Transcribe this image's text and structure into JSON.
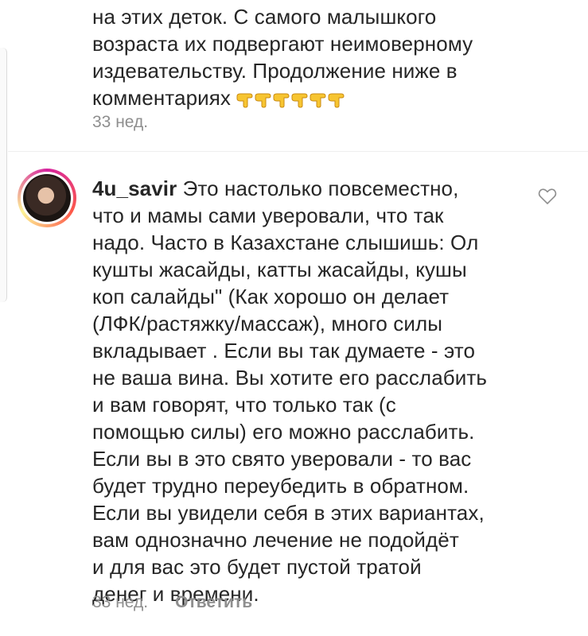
{
  "previous_comment": {
    "lines": [
      "на этих деток. С самого малышкого",
      "возраста их подвергают неимоверному",
      "издевательству. Продолжение ниже в",
      "комментариях"
    ],
    "emoji_icons": [
      "pointing-hand-icon",
      "pointing-hand-icon",
      "pointing-hand-icon",
      "pointing-hand-icon",
      "pointing-hand-icon",
      "pointing-hand-icon"
    ],
    "time": "33 нед."
  },
  "comment": {
    "username": "4u_savir",
    "lines": [
      "Это настолько повсеместно,",
      "что и мамы сами уверовали, что так",
      "надо.  Часто в Казахстане слышишь: Ол",
      "кушты жасайды, катты жасайды, кушы",
      "коп салайды\" (Как хорошо он делает",
      "(ЛФК/растяжку/массаж), много силы",
      "вкладывает .  Если вы так думаете - это",
      "не ваша вина. Вы хотите его расслабить",
      "и вам говорят, что только так (с",
      "помощью силы) его можно расслабить.",
      "Если вы в это свято уверовали - то вас",
      "будет трудно переубедить в обратном.",
      "Если вы увидели себя в этих вариантах,",
      "вам однозначно лечение не подойдёт",
      "и для вас это будет пустой тратой",
      "денег и времени."
    ],
    "time": "33 нед.",
    "reply_label": "Ответить",
    "like_icon": "heart-icon"
  },
  "colors": {
    "text": "#262626",
    "muted": "#8e8e8e",
    "divider": "#efefef",
    "emoji": "#f7c531"
  }
}
